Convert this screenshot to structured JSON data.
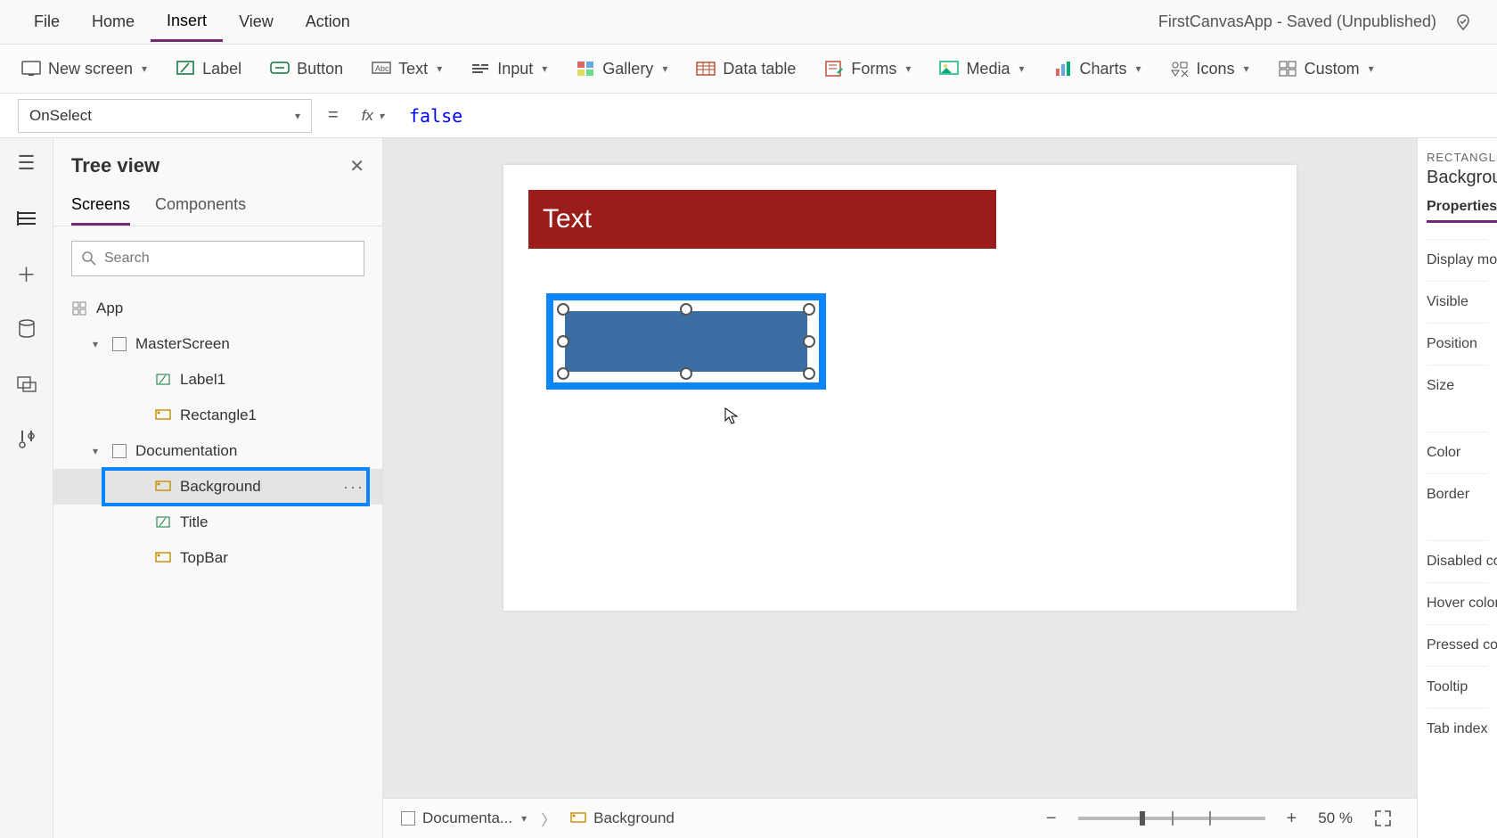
{
  "app_title": "FirstCanvasApp - Saved (Unpublished)",
  "menu": {
    "file": "File",
    "home": "Home",
    "insert": "Insert",
    "view": "View",
    "action": "Action"
  },
  "ribbon": {
    "new_screen": "New screen",
    "label": "Label",
    "button": "Button",
    "text": "Text",
    "input": "Input",
    "gallery": "Gallery",
    "data_table": "Data table",
    "forms": "Forms",
    "media": "Media",
    "charts": "Charts",
    "icons": "Icons",
    "custom": "Custom"
  },
  "formula": {
    "property": "OnSelect",
    "fx": "fx",
    "value": "false"
  },
  "tree": {
    "title": "Tree view",
    "tabs": {
      "screens": "Screens",
      "components": "Components"
    },
    "search_placeholder": "Search",
    "app": "App",
    "nodes": {
      "master": "MasterScreen",
      "label1": "Label1",
      "rect1": "Rectangle1",
      "doc": "Documentation",
      "background": "Background",
      "title_ctl": "Title",
      "topbar": "TopBar"
    }
  },
  "canvas": {
    "label_text": "Text"
  },
  "status": {
    "screen_crumb": "Documenta...",
    "control_crumb": "Background",
    "zoom": "50 %"
  },
  "right": {
    "type": "RECTANGLE",
    "name": "Backgroun",
    "tab": "Properties",
    "props": {
      "display_mode": "Display mod",
      "visible": "Visible",
      "position": "Position",
      "size": "Size",
      "color": "Color",
      "border": "Border",
      "disabled": "Disabled co",
      "hover": "Hover color",
      "pressed": "Pressed col",
      "tooltip": "Tooltip",
      "tabindex": "Tab index"
    }
  }
}
